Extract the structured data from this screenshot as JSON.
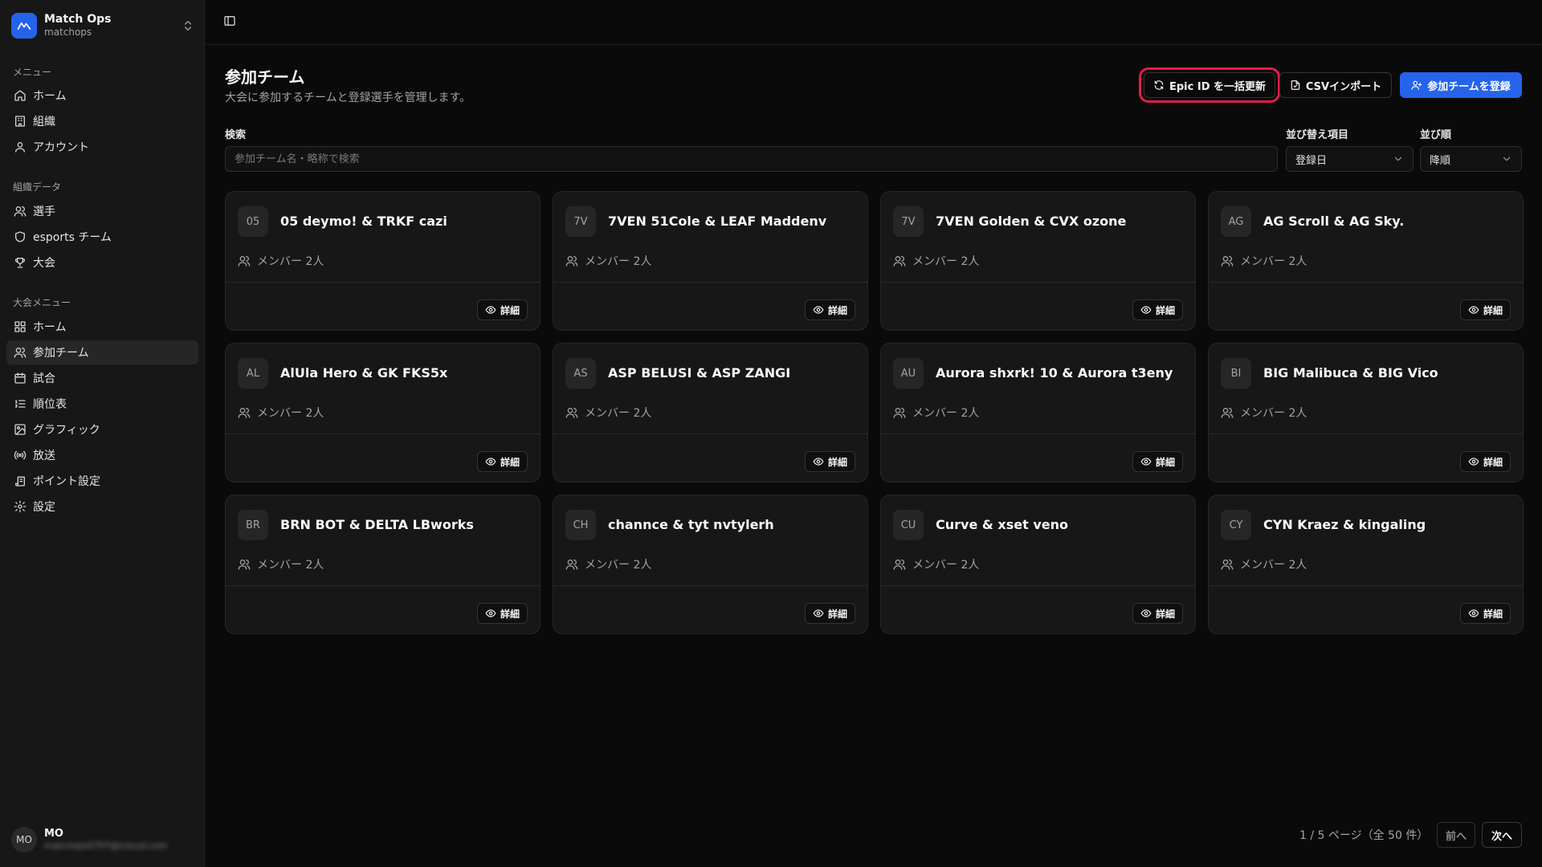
{
  "workspace": {
    "name": "Match Ops",
    "sub": "matchops"
  },
  "sidebar": {
    "groups": [
      {
        "label": "メニュー",
        "items": [
          {
            "label": "ホーム",
            "icon": "home-icon"
          },
          {
            "label": "組織",
            "icon": "building-icon"
          },
          {
            "label": "アカウント",
            "icon": "user-icon"
          }
        ]
      },
      {
        "label": "組織データ",
        "items": [
          {
            "label": "選手",
            "icon": "users-icon"
          },
          {
            "label": "esports チーム",
            "icon": "shield-icon"
          },
          {
            "label": "大会",
            "icon": "trophy-icon"
          }
        ]
      },
      {
        "label": "大会メニュー",
        "items": [
          {
            "label": "ホーム",
            "icon": "grid-icon"
          },
          {
            "label": "参加チーム",
            "icon": "users-icon",
            "active": true
          },
          {
            "label": "試合",
            "icon": "calendar-icon"
          },
          {
            "label": "順位表",
            "icon": "list-ordered-icon"
          },
          {
            "label": "グラフィック",
            "icon": "image-icon"
          },
          {
            "label": "放送",
            "icon": "radio-icon"
          },
          {
            "label": "ポイント設定",
            "icon": "scroll-icon"
          },
          {
            "label": "設定",
            "icon": "gear-icon"
          }
        ]
      }
    ]
  },
  "user": {
    "initials": "MO",
    "name": "MO",
    "email": "matchops0707@icloud.com"
  },
  "header": {
    "title": "参加チーム",
    "description": "大会に参加するチームと登録選手を管理します。",
    "buttons": {
      "epic": "Epic ID を一括更新",
      "csv": "CSVインポート",
      "register": "参加チームを登録"
    }
  },
  "filters": {
    "search_label": "検索",
    "search_placeholder": "参加チーム名・略称で検索",
    "sort_field_label": "並び替え項目",
    "sort_field_value": "登録日",
    "sort_order_label": "並び順",
    "sort_order_value": "降順"
  },
  "cards": {
    "members_label": "メンバー 2人",
    "detail_label": "詳細",
    "teams": [
      {
        "abbr": "05",
        "name": "05 deymo! & TRKF cazi"
      },
      {
        "abbr": "7V",
        "name": "7VEN 51Cole & LEAF Maddenv"
      },
      {
        "abbr": "7V",
        "name": "7VEN Golden & CVX ozone"
      },
      {
        "abbr": "AG",
        "name": "AG Scroll & AG Sky."
      },
      {
        "abbr": "AL",
        "name": "AlUla Hero & GK FKS5x"
      },
      {
        "abbr": "AS",
        "name": "ASP BELUSI & ASP ZANGI"
      },
      {
        "abbr": "AU",
        "name": "Aurora shxrk! 10 & Aurora t3eny"
      },
      {
        "abbr": "BI",
        "name": "BIG Malibuca & BIG Vico"
      },
      {
        "abbr": "BR",
        "name": "BRN BOT & DELTA LBworks"
      },
      {
        "abbr": "CH",
        "name": "channce & tyt nvtylerh"
      },
      {
        "abbr": "CU",
        "name": "Curve & xset veno"
      },
      {
        "abbr": "CY",
        "name": "CYN Kraez & kingaling"
      }
    ]
  },
  "pagination": {
    "text": "1 / 5 ページ（全 50 件）",
    "prev": "前へ",
    "next": "次へ"
  },
  "colors": {
    "accent": "#2563eb",
    "highlight": "#e11d48"
  }
}
